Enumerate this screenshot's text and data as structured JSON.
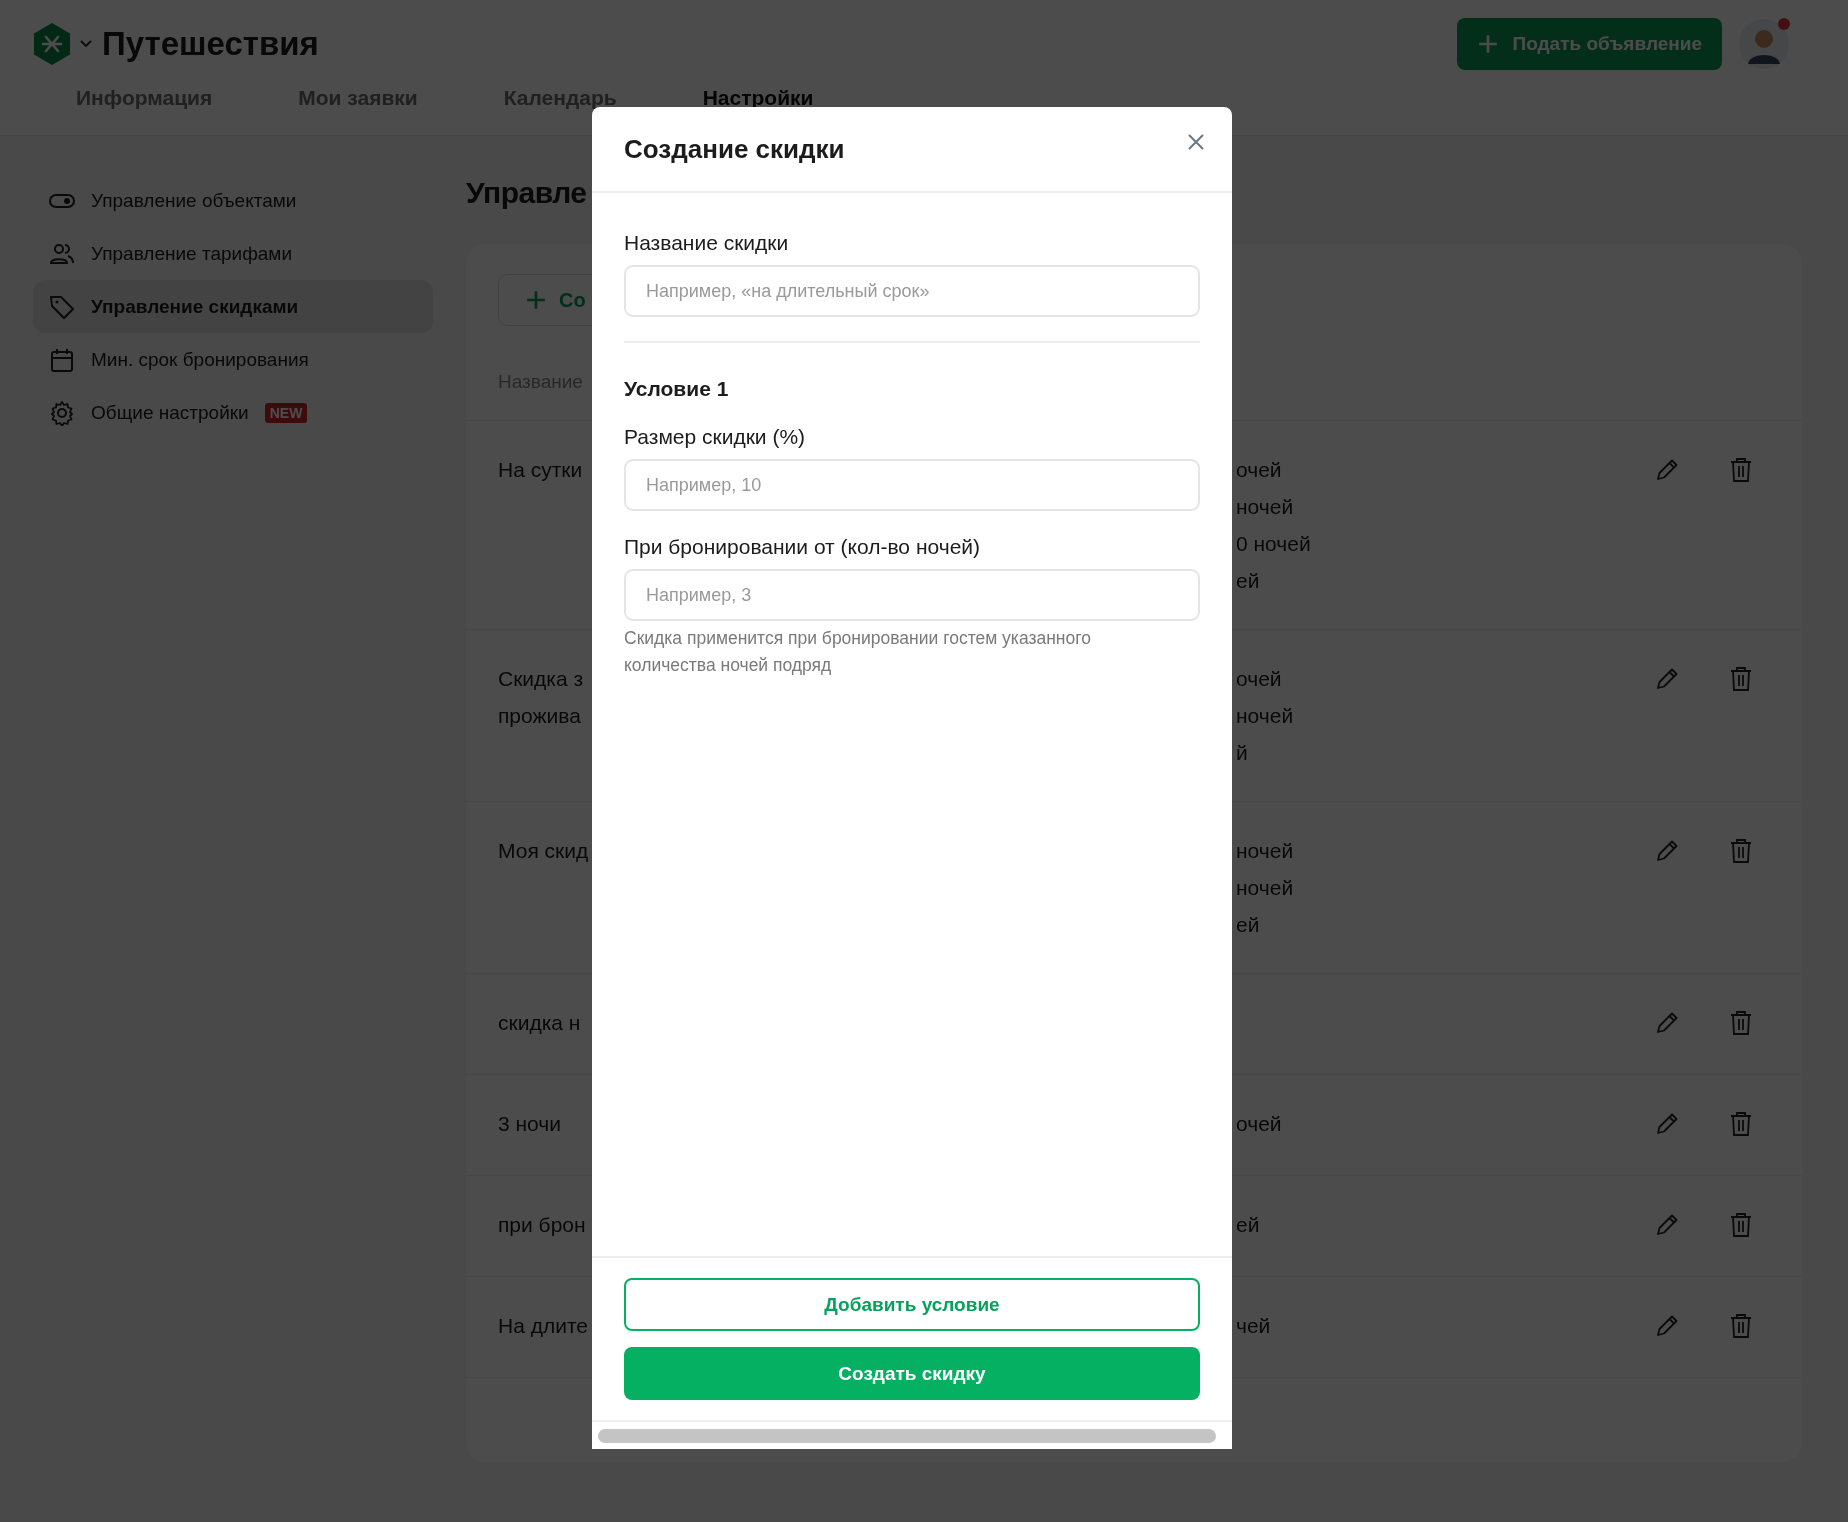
{
  "header": {
    "app_title": "Путешествия",
    "post_button": "Подать объявление"
  },
  "tabs": [
    {
      "label": "Информация",
      "selected": false
    },
    {
      "label": "Мои заявки",
      "selected": false
    },
    {
      "label": "Календарь",
      "selected": false
    },
    {
      "label": "Настройки",
      "selected": true
    }
  ],
  "sidebar": {
    "items": [
      {
        "label": "Управление объектами",
        "selected": false
      },
      {
        "label": "Управление тарифами",
        "selected": false
      },
      {
        "label": "Управление скидками",
        "selected": true
      },
      {
        "label": "Мин. срок бронирования",
        "selected": false
      },
      {
        "label": "Общие настройки",
        "selected": false,
        "badge": "NEW"
      }
    ]
  },
  "page": {
    "heading": "Управле",
    "create_button": "Со",
    "table": {
      "columns": [
        "Название"
      ],
      "rows": [
        {
          "name": [
            "На сутки"
          ],
          "conditions": [
            "очей",
            "ночей",
            "0 ночей",
            "ей"
          ]
        },
        {
          "name": [
            "Скидка з",
            "прожива"
          ],
          "conditions": [
            "очей",
            "ночей",
            "й"
          ]
        },
        {
          "name": [
            "Моя скид"
          ],
          "conditions": [
            "ночей",
            "ночей",
            "ей"
          ]
        },
        {
          "name": [
            "скидка н"
          ]
        },
        {
          "name": [
            "3 ночи"
          ],
          "conditions": [
            "очей"
          ]
        },
        {
          "name": [
            "при брон"
          ],
          "conditions": [
            "ей"
          ]
        },
        {
          "name": [
            "На длите"
          ],
          "conditions": [
            "чей"
          ]
        }
      ]
    }
  },
  "modal": {
    "title": "Создание скидки",
    "name_field": {
      "label": "Название скидки",
      "placeholder": "Например, «на длительный срок»"
    },
    "condition": {
      "title": "Условие 1",
      "fields": [
        {
          "label": "Размер скидки (%)",
          "placeholder": "Например, 10"
        },
        {
          "label": "При бронировании от (кол-во ночей)",
          "placeholder": "Например, 3",
          "hint": "Скидка применится при бронировании гостем указанного количества ночей подряд"
        }
      ]
    },
    "add_condition_button": "Добавить условие",
    "create_button": "Создать скидку"
  }
}
